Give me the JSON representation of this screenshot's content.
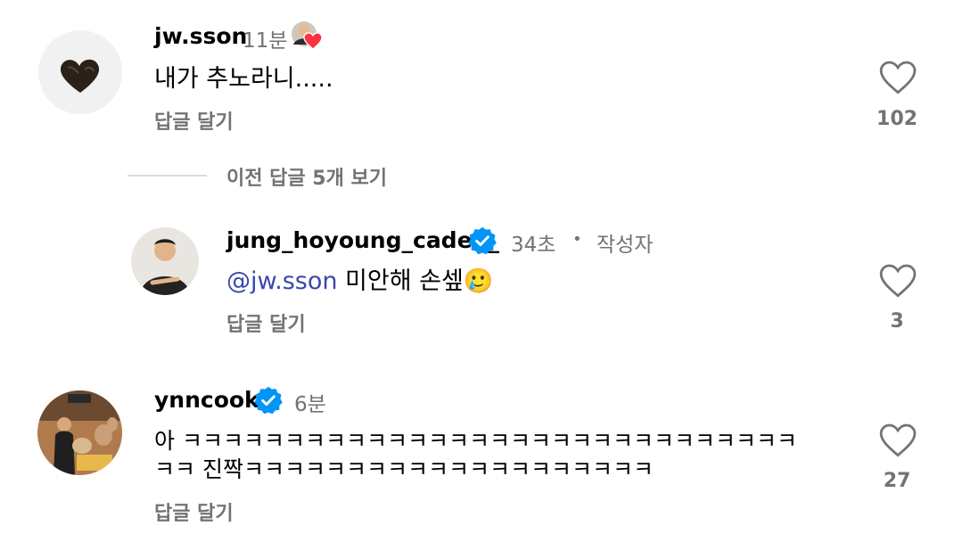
{
  "comments": [
    {
      "username": "jw.sson",
      "time": "11분",
      "text": "내가 추노라니.....",
      "reply_label": "답글 달기",
      "likes": "102",
      "avatar_icon": "truffle-heart-avatar",
      "creator_liked": true
    },
    {
      "username": "jung_hoyoung_caden_",
      "verified": true,
      "time": "34초",
      "author_tag": "작성자",
      "separator": "•",
      "mention": "@jw.sson",
      "text": " 미안해 손셒🥲",
      "reply_label": "답글 달기",
      "likes": "3",
      "avatar_icon": "chef-avatar"
    },
    {
      "username": "ynncook",
      "verified": true,
      "time": "6분",
      "text_line1": "아 ㅋㅋㅋㅋㅋㅋㅋㅋㅋㅋㅋㅋㅋㅋㅋㅋㅋㅋㅋㅋㅋㅋㅋㅋㅋㅋㅋㅋㅋㅋ",
      "text_line2": "ㅋㅋ 진짝ㅋㅋㅋㅋㅋㅋㅋㅋㅋㅋㅋㅋㅋㅋㅋㅋㅋㅋㅋㅋ",
      "reply_label": "답글 달기",
      "likes": "27",
      "avatar_icon": "dogs-avatar"
    }
  ],
  "view_previous_replies": "이전 답글 5개 보기",
  "colors": {
    "secondary_text": "#737373",
    "mention": "#3949ab",
    "verified": "#0095f6",
    "heart_outline": "#737373",
    "liked_heart": "#ff3040"
  }
}
